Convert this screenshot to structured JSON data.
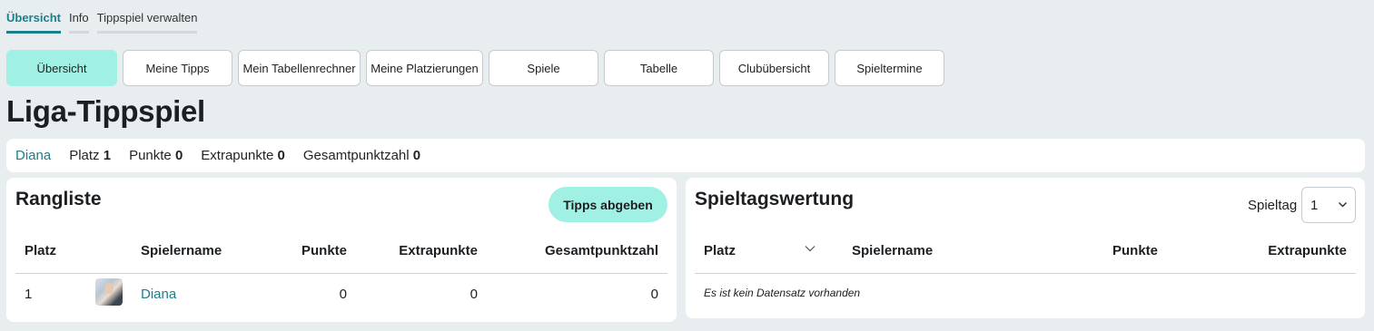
{
  "top_tabs": [
    {
      "label": "Übersicht",
      "active": true
    },
    {
      "label": "Info",
      "active": false
    },
    {
      "label": "Tippspiel verwalten",
      "active": false
    }
  ],
  "nav_buttons": [
    {
      "label": "Übersicht",
      "active": true
    },
    {
      "label": "Meine Tipps",
      "active": false
    },
    {
      "label": "Mein Tabellenrechner",
      "active": false
    },
    {
      "label": "Meine Platzierungen",
      "active": false
    },
    {
      "label": "Spiele",
      "active": false
    },
    {
      "label": "Tabelle",
      "active": false
    },
    {
      "label": "Clubübersicht",
      "active": false
    },
    {
      "label": "Spieltermine",
      "active": false
    }
  ],
  "page_title": "Liga-Tippspiel",
  "summary": {
    "user": "Diana",
    "platz_label": "Platz",
    "platz_value": "1",
    "punkte_label": "Punkte",
    "punkte_value": "0",
    "extra_label": "Extrapunkte",
    "extra_value": "0",
    "gesamt_label": "Gesamtpunktzahl",
    "gesamt_value": "0"
  },
  "rangliste": {
    "title": "Rangliste",
    "button": "Tipps abgeben",
    "headers": {
      "platz": "Platz",
      "spielername": "Spielername",
      "punkte": "Punkte",
      "extrapunkte": "Extrapunkte",
      "gesamt": "Gesamtpunktzahl"
    },
    "rows": [
      {
        "platz": "1",
        "name": "Diana",
        "punkte": "0",
        "extrapunkte": "0",
        "gesamt": "0"
      }
    ]
  },
  "spieltagswertung": {
    "title": "Spieltagswertung",
    "spieltag_label": "Spieltag",
    "spieltag_value": "1",
    "headers": {
      "platz": "Platz",
      "spielername": "Spielername",
      "punkte": "Punkte",
      "extrapunkte": "Extrapunkte"
    },
    "empty_text": "Es ist kein Datensatz vorhanden"
  },
  "colors": {
    "accent": "#1a7f8a",
    "active_button": "#a0f1e3",
    "background": "#e8edf0"
  },
  "icons": {
    "select": "chevron-down-icon",
    "sort": "chevron-down-icon"
  }
}
